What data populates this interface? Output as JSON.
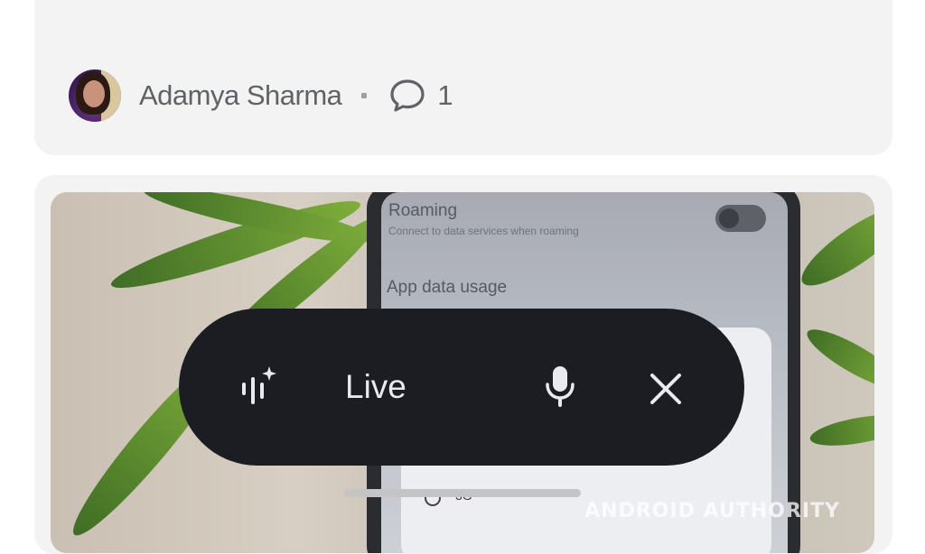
{
  "article_meta": {
    "author_name": "Adamya Sharma",
    "comment_count": "1",
    "icons": {
      "comment": "comment-bubble-icon",
      "separator": "dot-separator"
    }
  },
  "photo": {
    "phone_screen": {
      "roaming_label": "Roaming",
      "roaming_sub": "Connect to data services when roaming",
      "app_data_label": "App data usage",
      "network_option": "3G"
    },
    "watermark": "ANDROID AUTHORITY"
  },
  "live_bar": {
    "label": "Live",
    "icons": {
      "left": "gemini-live-sparkle-icon",
      "mic": "microphone-icon",
      "close": "close-icon"
    }
  },
  "colors": {
    "pill_bg": "#1c1d22",
    "card_bg": "#f3f3f3",
    "text_gray": "#5f6368"
  }
}
